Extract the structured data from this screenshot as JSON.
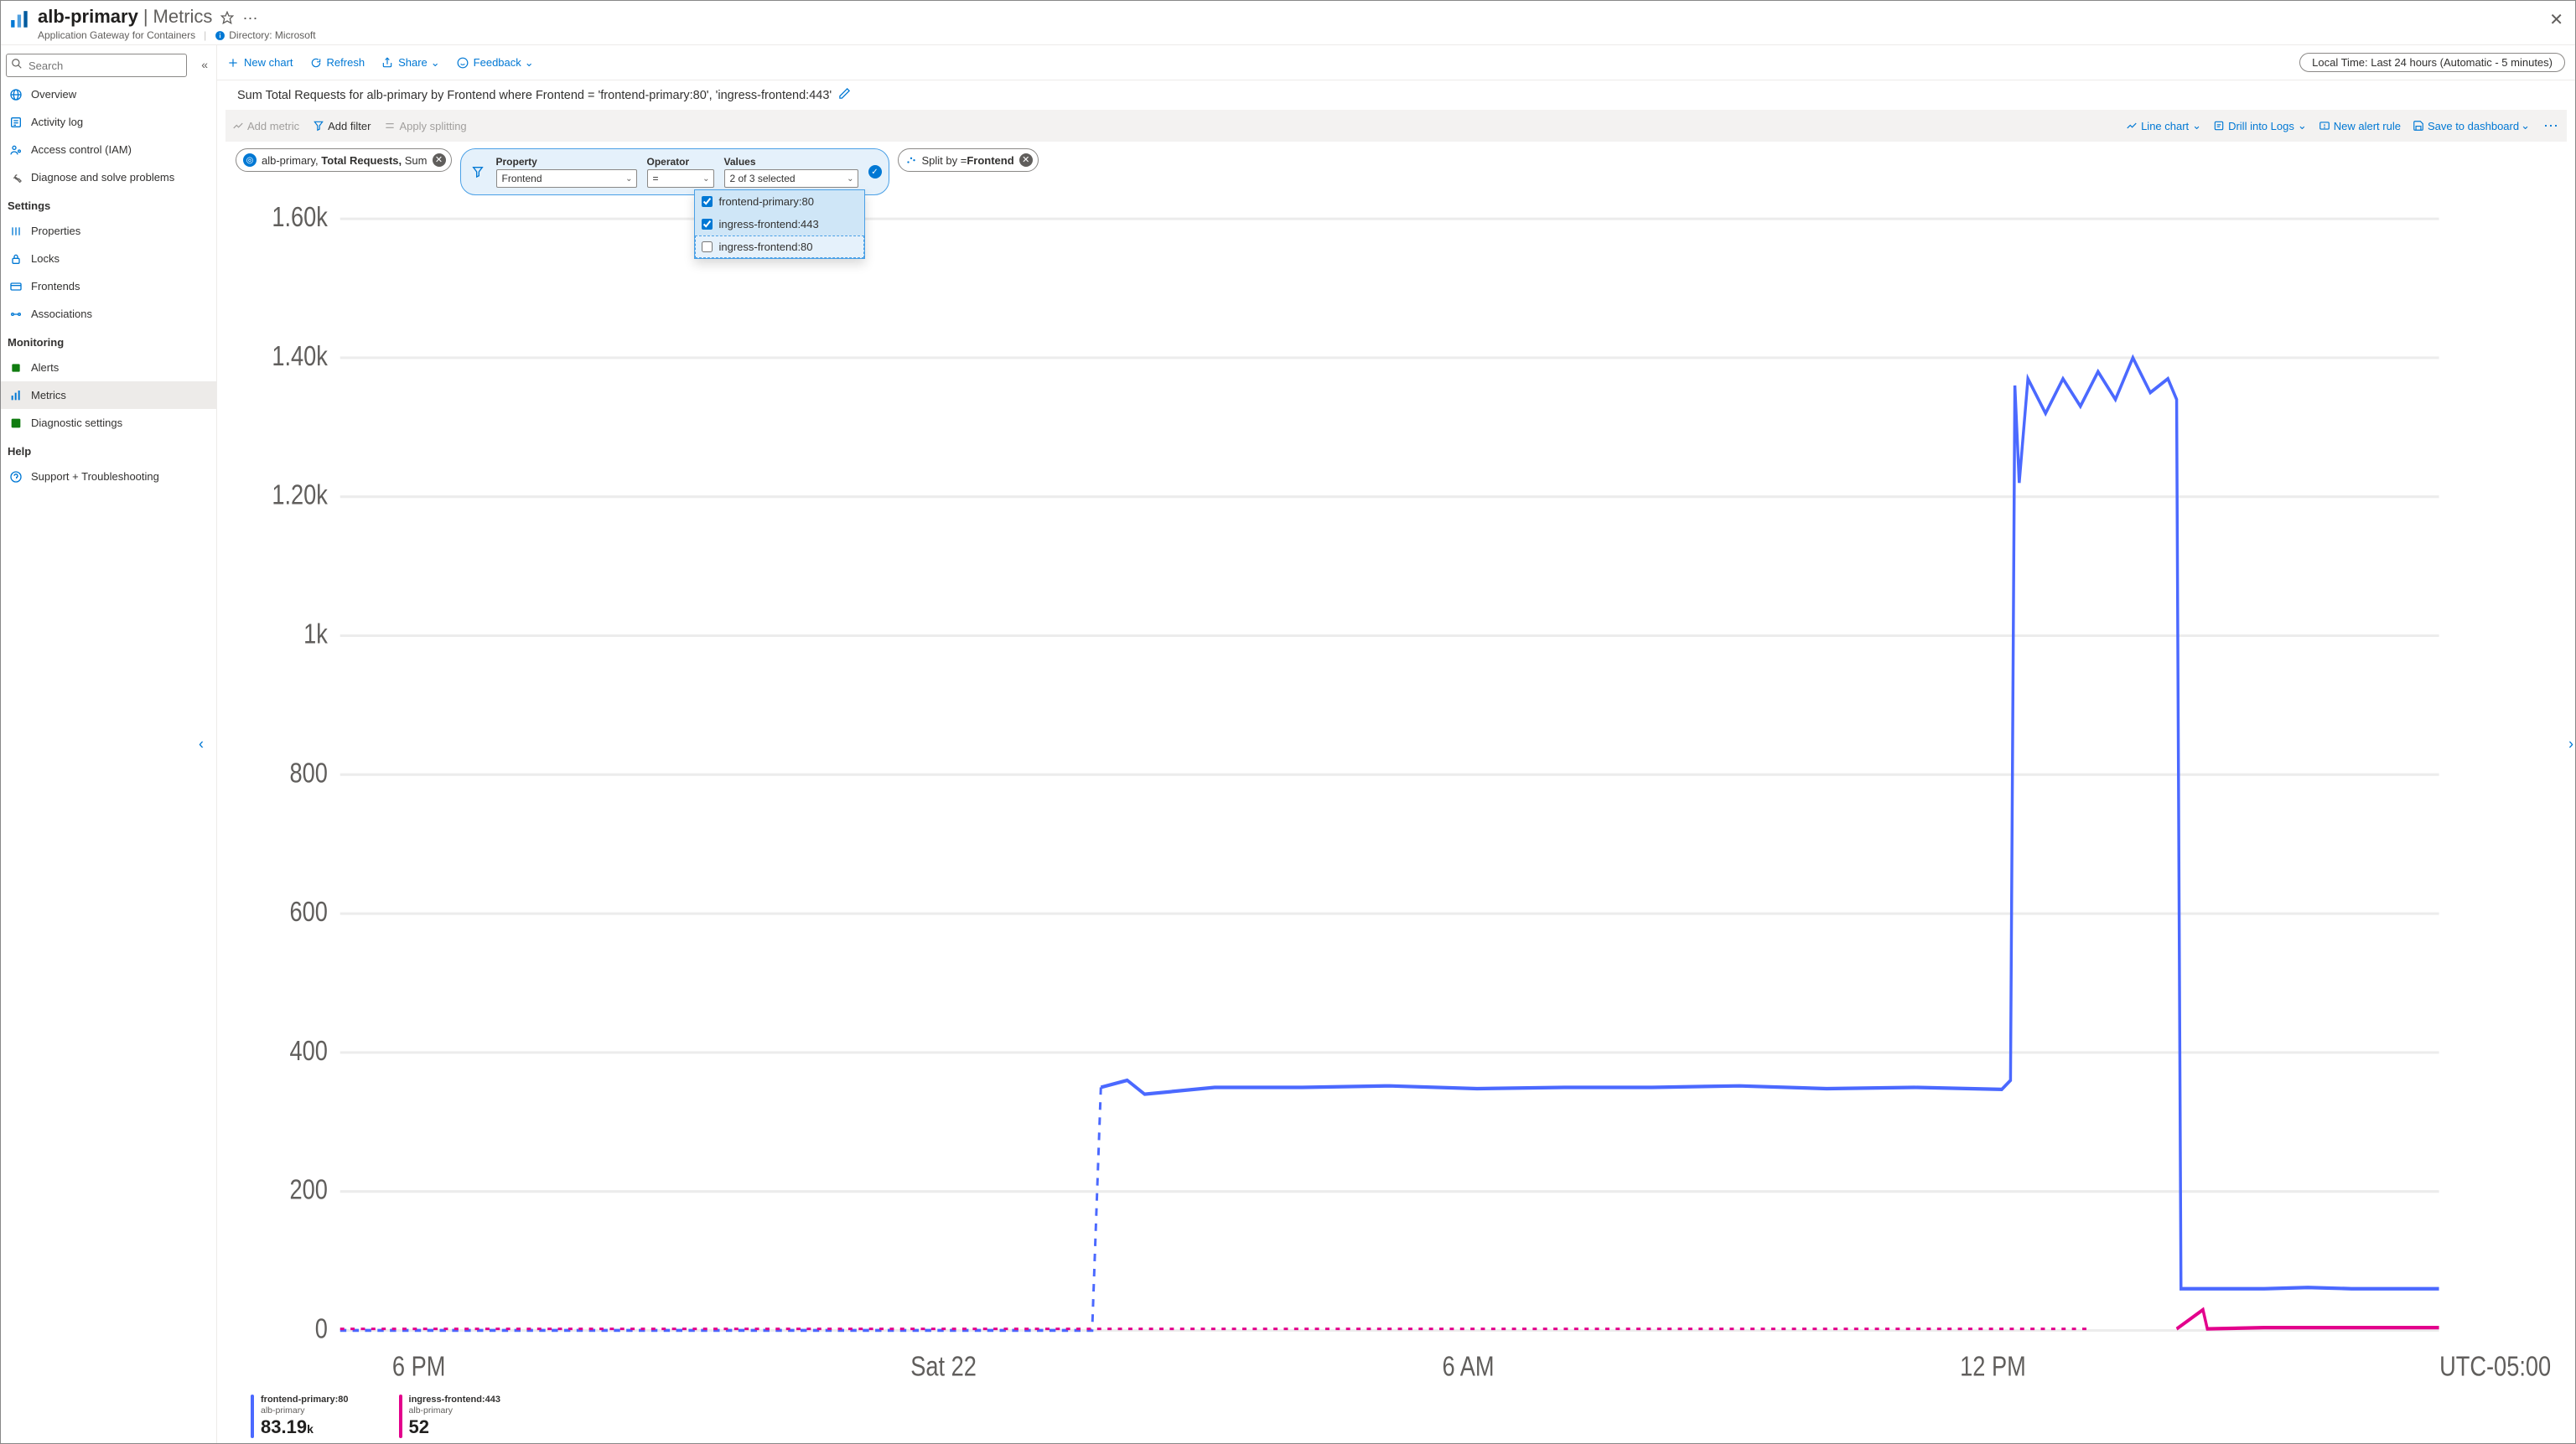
{
  "header": {
    "resource_name": "alb-primary",
    "page_name": "Metrics",
    "type_line": "Application Gateway for Containers",
    "directory_label": "Directory: Microsoft"
  },
  "sidebar": {
    "search_placeholder": "Search",
    "top": [
      {
        "icon": "globe",
        "label": "Overview"
      },
      {
        "icon": "activity",
        "label": "Activity log"
      },
      {
        "icon": "iam",
        "label": "Access control (IAM)"
      },
      {
        "icon": "wrench",
        "label": "Diagnose and solve problems"
      }
    ],
    "settings_label": "Settings",
    "settings": [
      {
        "icon": "props",
        "label": "Properties"
      },
      {
        "icon": "lock",
        "label": "Locks"
      },
      {
        "icon": "frontends",
        "label": "Frontends"
      },
      {
        "icon": "assoc",
        "label": "Associations"
      }
    ],
    "monitoring_label": "Monitoring",
    "monitoring": [
      {
        "icon": "alerts",
        "label": "Alerts"
      },
      {
        "icon": "metrics",
        "label": "Metrics",
        "selected": true
      },
      {
        "icon": "diag",
        "label": "Diagnostic settings"
      }
    ],
    "help_label": "Help",
    "help": [
      {
        "icon": "support",
        "label": "Support + Troubleshooting"
      }
    ]
  },
  "toolbar": {
    "new_chart": "New chart",
    "refresh": "Refresh",
    "share": "Share",
    "feedback": "Feedback",
    "time_range": "Local Time: Last 24 hours (Automatic - 5 minutes)"
  },
  "query": "Sum Total Requests for alb-primary by Frontend where Frontend = 'frontend-primary:80', 'ingress-frontend:443'",
  "graybar": {
    "add_metric": "Add metric",
    "add_filter": "Add filter",
    "apply_splitting": "Apply splitting",
    "line_chart": "Line chart",
    "drill_logs": "Drill into Logs",
    "new_alert": "New alert rule",
    "save_dash": "Save to dashboard"
  },
  "metric_pill": {
    "resource": "alb-primary,",
    "metric": "Total Requests,",
    "agg": "Sum"
  },
  "filter": {
    "property_label": "Property",
    "property_value": "Frontend",
    "operator_label": "Operator",
    "operator_value": "=",
    "values_label": "Values",
    "values_summary": "2 of 3 selected",
    "options": [
      {
        "label": "frontend-primary:80",
        "checked": true
      },
      {
        "label": "ingress-frontend:443",
        "checked": true
      },
      {
        "label": "ingress-frontend:80",
        "checked": false
      }
    ]
  },
  "split_pill": {
    "prefix": "Split by = ",
    "value": "Frontend"
  },
  "chart_data": {
    "type": "line",
    "ylabel": "",
    "xlabel": "",
    "y_ticks": [
      "1.60k",
      "1.40k",
      "1.20k",
      "1k",
      "800",
      "600",
      "400",
      "200",
      "0"
    ],
    "ylim": [
      0,
      1600
    ],
    "x_ticks": [
      "6 PM",
      "Sat 22",
      "6 AM",
      "12 PM"
    ],
    "x_range_hours": 24,
    "timezone_label": "UTC-05:00",
    "series": [
      {
        "name": "frontend-primary:80",
        "resource": "alb-primary",
        "color": "#4b69ff",
        "summary_value": "83.19",
        "summary_suffix": "k",
        "points_hours_value": [
          [
            0,
            0
          ],
          [
            1,
            0
          ],
          [
            2,
            0
          ],
          [
            3,
            0
          ],
          [
            4,
            0
          ],
          [
            5,
            0
          ],
          [
            6,
            0
          ],
          [
            7,
            0
          ],
          [
            8,
            0
          ],
          [
            8.6,
            0
          ],
          [
            8.7,
            350
          ],
          [
            9,
            360
          ],
          [
            9.2,
            340
          ],
          [
            10,
            350
          ],
          [
            11,
            350
          ],
          [
            12,
            352
          ],
          [
            13,
            348
          ],
          [
            14,
            350
          ],
          [
            15,
            350
          ],
          [
            16,
            352
          ],
          [
            17,
            348
          ],
          [
            18,
            350
          ],
          [
            19,
            347
          ],
          [
            19.1,
            360
          ],
          [
            19.15,
            1360
          ],
          [
            19.2,
            1220
          ],
          [
            19.3,
            1370
          ],
          [
            19.5,
            1320
          ],
          [
            19.7,
            1370
          ],
          [
            19.9,
            1330
          ],
          [
            20.1,
            1380
          ],
          [
            20.3,
            1340
          ],
          [
            20.5,
            1400
          ],
          [
            20.7,
            1350
          ],
          [
            20.9,
            1370
          ],
          [
            21.0,
            1340
          ],
          [
            21.05,
            60
          ],
          [
            21.5,
            60
          ],
          [
            22,
            60
          ],
          [
            22.5,
            62
          ],
          [
            23,
            60
          ],
          [
            23.5,
            60
          ],
          [
            24,
            60
          ]
        ]
      },
      {
        "name": "ingress-frontend:443",
        "resource": "alb-primary",
        "color": "#e3008c",
        "summary_value": "52",
        "summary_suffix": "",
        "points_hours_value": [
          [
            0,
            2
          ],
          [
            2,
            2
          ],
          [
            4,
            2
          ],
          [
            6,
            2
          ],
          [
            8,
            2
          ],
          [
            10,
            2
          ],
          [
            12,
            2
          ],
          [
            14,
            2
          ],
          [
            16,
            2
          ],
          [
            18,
            2
          ],
          [
            20,
            2
          ],
          [
            21.0,
            2
          ],
          [
            21.3,
            30
          ],
          [
            21.35,
            2
          ],
          [
            22,
            4
          ],
          [
            24,
            4
          ]
        ]
      }
    ]
  }
}
